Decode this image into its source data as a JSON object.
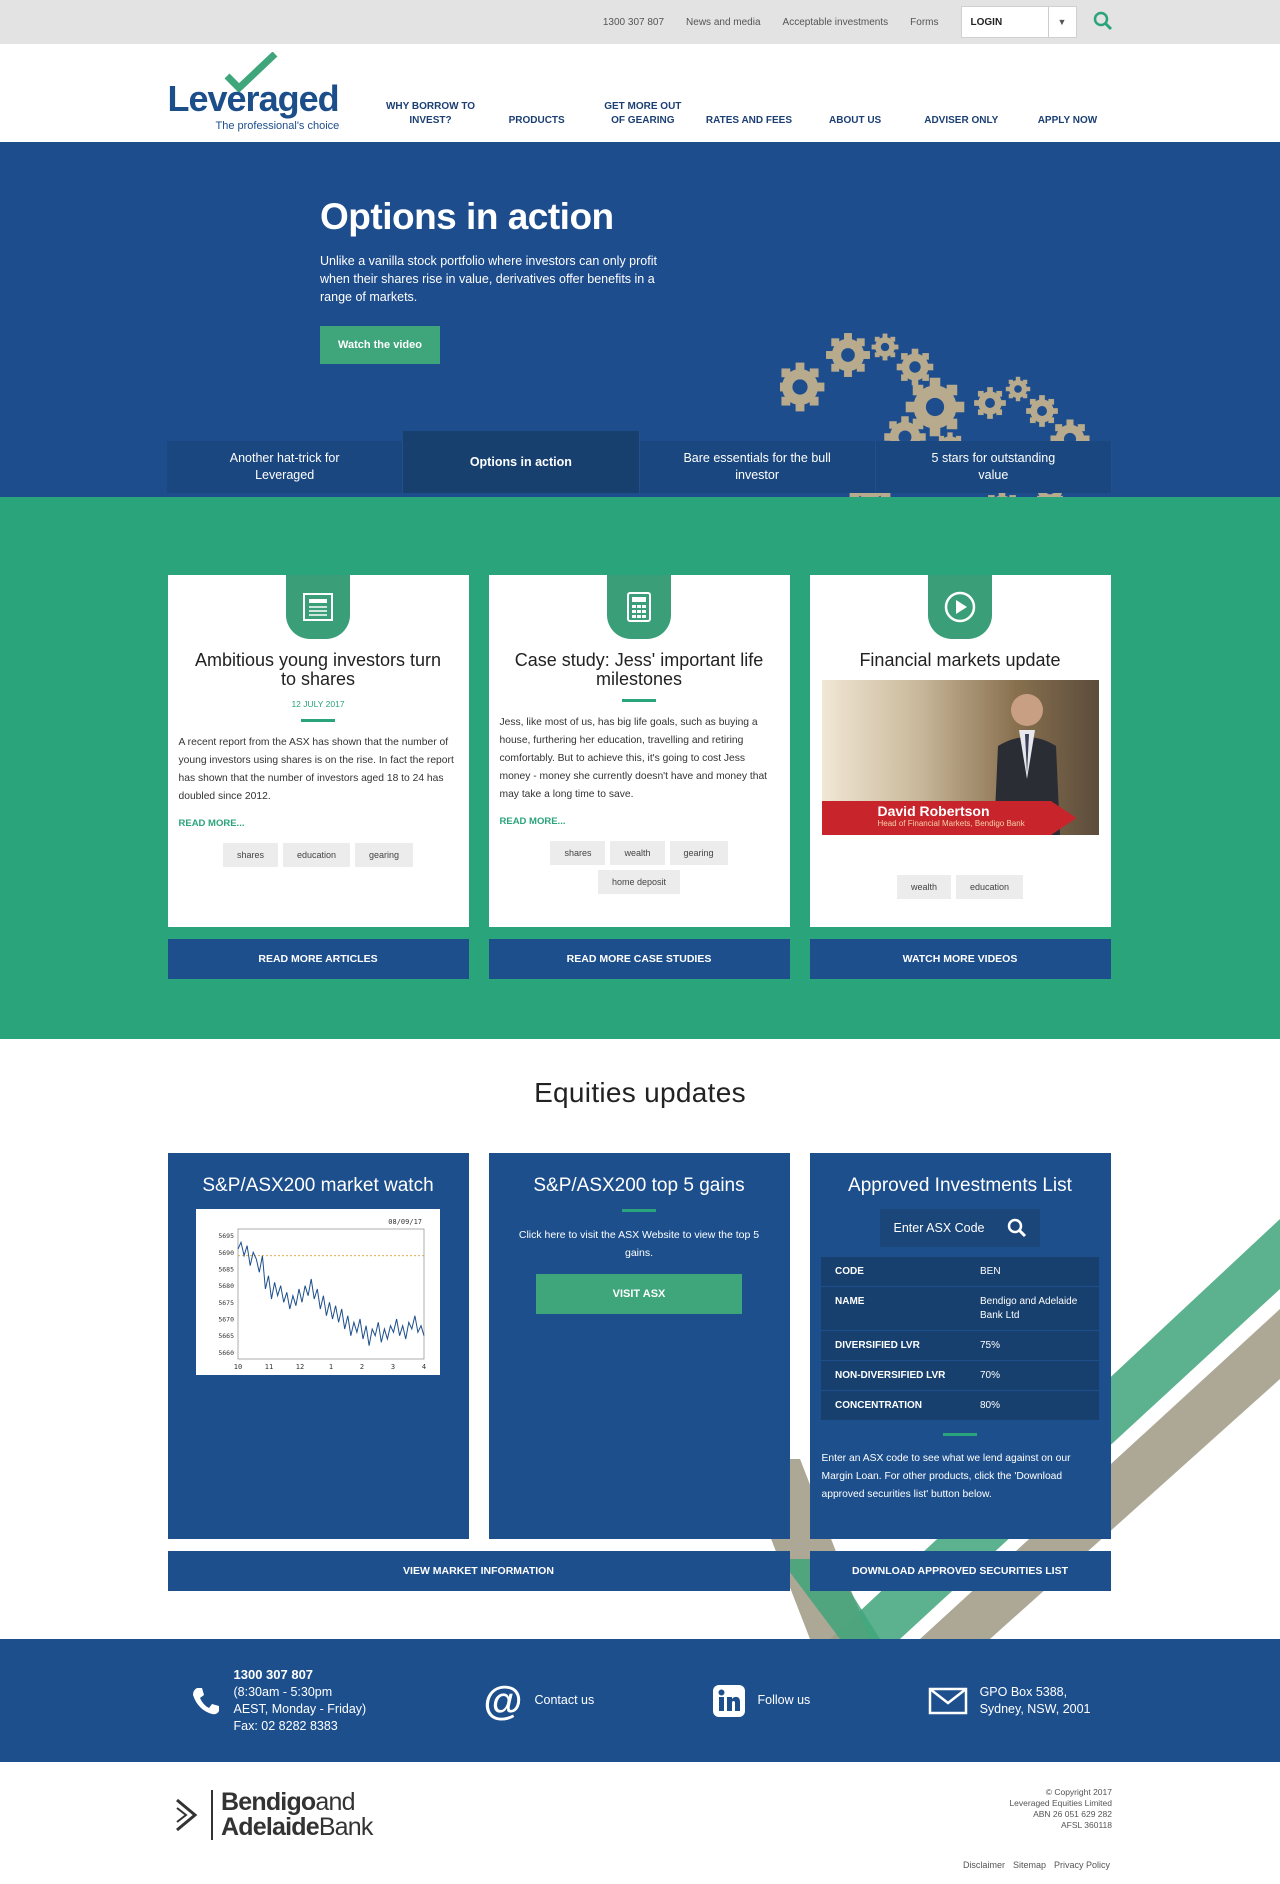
{
  "utility": {
    "phone": "1300 307 807",
    "news": "News and media",
    "acceptable": "Acceptable investments",
    "forms": "Forms",
    "login": "LOGIN"
  },
  "brand": {
    "wordmark": "Leveraged",
    "tagline": "The professional's choice",
    "accent": "#3fa57a",
    "navy": "#1d4f8c"
  },
  "nav": [
    "WHY BORROW TO INVEST?",
    "PRODUCTS",
    "GET MORE OUT OF GEARING",
    "RATES AND FEES",
    "ABOUT US",
    "ADVISER ONLY",
    "APPLY NOW"
  ],
  "hero": {
    "title": "Options in action",
    "body": "Unlike a vanilla stock portfolio where investors can only profit when their shares rise in value, derivatives offer benefits in a range of markets.",
    "button": "Watch the video",
    "tabs": [
      "Another hat-trick for Leveraged",
      "Options in action",
      "Bare essentials for the bull investor",
      "5 stars for outstanding value"
    ]
  },
  "cards": [
    {
      "title": "Ambitious young investors turn to shares",
      "date": "12 JULY 2017",
      "body": "A recent report from the ASX has shown that the number of young investors using shares is on the rise. In fact the report has shown that the number of investors aged 18 to 24 has doubled since 2012.",
      "more": "READ MORE...",
      "tags": [
        "shares",
        "education",
        "gearing"
      ],
      "cta": "READ MORE ARTICLES"
    },
    {
      "title": "Case study: Jess' important life milestones",
      "body": "Jess, like most of us, has big life goals, such as buying a house, furthering her education, travelling and retiring comfortably. But to achieve this, it's going to cost Jess money - money she currently doesn't have and money that may take a long time to save.",
      "more": "READ MORE...",
      "tags": [
        "shares",
        "wealth",
        "gearing",
        "home deposit"
      ],
      "cta": "READ MORE CASE STUDIES"
    },
    {
      "title": "Financial markets update",
      "video_name": "David Robertson",
      "video_role": "Head of Financial Markets, Bendigo Bank",
      "tags": [
        "wealth",
        "education"
      ],
      "cta": "WATCH MORE VIDEOS"
    }
  ],
  "equities": {
    "heading": "Equities updates",
    "watch_title": "S&P/ASX200 market watch",
    "gains_title": "S&P/ASX200 top 5 gains",
    "gains_body": "Click here to visit the ASX Website to view the top 5 gains.",
    "visit": "VISIT ASX",
    "ail_title": "Approved Investments List",
    "asx_placeholder": "Enter ASX Code",
    "ail_rows": [
      {
        "k": "CODE",
        "v": "BEN"
      },
      {
        "k": "NAME",
        "v": "Bendigo and Adelaide Bank Ltd"
      },
      {
        "k": "DIVERSIFIED LVR",
        "v": "75%"
      },
      {
        "k": "NON-DIVERSIFIED LVR",
        "v": "70%"
      },
      {
        "k": "CONCENTRATION",
        "v": "80%"
      }
    ],
    "ail_note": "Enter an ASX code to see what we lend against on our Margin Loan. For other products, click the 'Download approved securities list' button below.",
    "cta_market": "VIEW MARKET INFORMATION",
    "cta_download": "DOWNLOAD APPROVED SECURITIES LIST"
  },
  "chart_data": {
    "type": "line",
    "title": "",
    "date_label": "08/09/17",
    "xlabel": "",
    "ylabel": "",
    "x_ticks": [
      "10",
      "11",
      "12",
      "1",
      "2",
      "3",
      "4"
    ],
    "y_ticks": [
      5695,
      5690,
      5685,
      5680,
      5675,
      5670,
      5665,
      5660
    ],
    "ylim": [
      5658,
      5697
    ],
    "reference_line": 5689,
    "series": [
      {
        "values": [
          5691,
          5693,
          5689,
          5692,
          5686,
          5690,
          5688,
          5684,
          5689,
          5679,
          5683,
          5676,
          5681,
          5677,
          5680,
          5675,
          5678,
          5673,
          5677,
          5674,
          5679,
          5675,
          5680,
          5677,
          5682,
          5676,
          5679,
          5673,
          5677,
          5671,
          5675,
          5670,
          5674,
          5669,
          5673,
          5667,
          5671,
          5665,
          5669,
          5666,
          5670,
          5664,
          5668,
          5662,
          5667,
          5665,
          5669,
          5663,
          5667,
          5664,
          5668,
          5666,
          5670,
          5665,
          5668,
          5664,
          5669,
          5667,
          5671,
          5666,
          5668,
          5665
        ]
      }
    ]
  },
  "contact": {
    "phone": "1300 307 807",
    "hours1": "(8:30am - 5:30pm",
    "hours2": "AEST, Monday - Friday)",
    "fax": "Fax: 02 8282 8383",
    "contact": "Contact us",
    "follow": "Follow us",
    "addr1": "GPO Box 5388,",
    "addr2": "Sydney, NSW, 2001"
  },
  "footer": {
    "bank1": "Bendigo",
    "bank1b": "and",
    "bank2": "Adelaide",
    "bank2b": "Bank",
    "copy1": "© Copyright 2017",
    "copy2": "Leveraged Equities Limited",
    "copy3": "ABN 26 051 629 282",
    "copy4": "AFSL 360118",
    "disclaimer": "Disclaimer",
    "sitemap": "Sitemap",
    "privacy": "Privacy Policy"
  }
}
